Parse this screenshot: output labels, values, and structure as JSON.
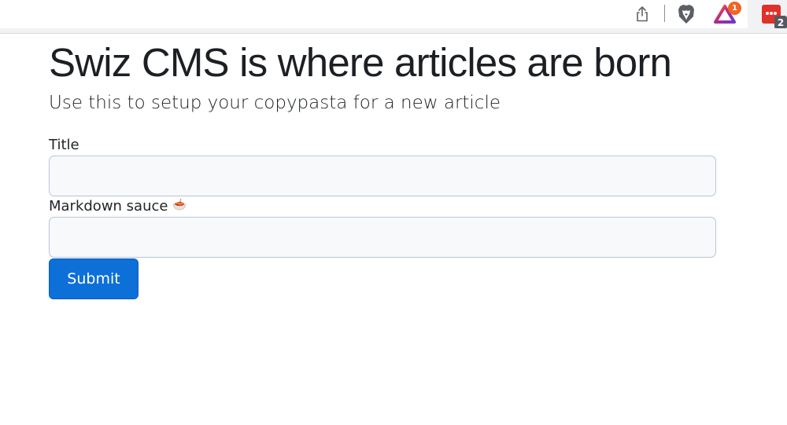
{
  "browser_toolbar": {
    "icons": [
      "share-icon",
      "brave-shields-icon",
      "brave-rewards-icon",
      "extension-icon"
    ],
    "rewards_badge": "1",
    "extension_badge": "2",
    "colors": {
      "rewards_badge": "#f06424",
      "extension_icon": "#e0312b"
    }
  },
  "page": {
    "title": "Swiz CMS is where articles are born",
    "subtitle": "Use this to setup your copypasta for a new article"
  },
  "form": {
    "title_label": "Title",
    "title_value": "",
    "markdown_label": "Markdown sauce",
    "markdown_icon": "spaghetti-emoji",
    "markdown_value": "",
    "submit_label": "Submit"
  },
  "colors": {
    "primary_button": "#0d6fd8",
    "input_border": "#b8c6d9",
    "input_background": "#f8f9fb"
  }
}
